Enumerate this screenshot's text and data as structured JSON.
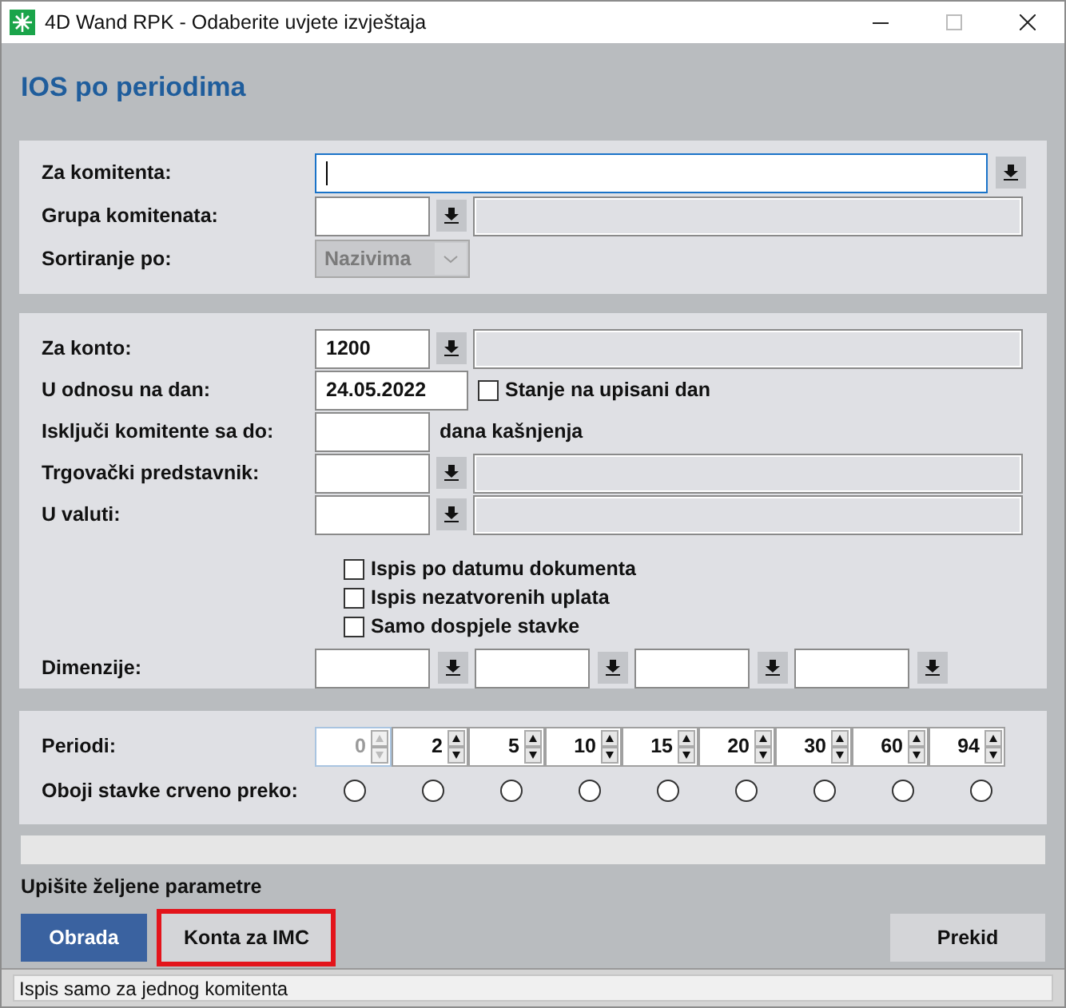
{
  "window": {
    "title": "4D Wand RPK - Odaberite uvjete izvještaja"
  },
  "heading": "IOS po periodima",
  "panel_1": [
    {
      "kind": "wide_lookup",
      "label": "Za komitenta:",
      "focused": true
    },
    {
      "kind": "lookup",
      "label": "Grupa komitenata:"
    },
    {
      "kind": "select",
      "label": "Sortiranje po:",
      "value": "Nazivima",
      "disabled": true
    }
  ],
  "panel_2": [
    {
      "kind": "lookup",
      "label": "Za konto:",
      "value": "1200"
    },
    {
      "kind": "date",
      "label": "U odnosu na dan:",
      "value": "24.05.2022",
      "option": {
        "label": "Stanje na upisani dan",
        "checked": false
      }
    },
    {
      "kind": "days",
      "label": "Isključi komitente sa do:",
      "suffix": "dana kašnjenja"
    },
    {
      "kind": "lookup",
      "label": "Trgovački predstavnik:"
    },
    {
      "kind": "lookup",
      "label": "U valuti:"
    },
    {
      "kind": "checkbox",
      "label": "Ispis po datumu dokumenta",
      "checked": false
    },
    {
      "kind": "checkbox",
      "label": "Ispis nezatvorenih uplata",
      "checked": false
    },
    {
      "kind": "checkbox",
      "label": "Samo dospjele stavke",
      "checked": false
    },
    {
      "kind": "dimensions",
      "label": "Dimenzije:"
    }
  ],
  "periods": {
    "label": "Periodi:",
    "values": [
      {
        "value": "0",
        "disabled": true
      },
      {
        "value": "2",
        "disabled": false
      },
      {
        "value": "5",
        "disabled": false
      },
      {
        "value": "10",
        "disabled": false
      },
      {
        "value": "15",
        "disabled": false
      },
      {
        "value": "20",
        "disabled": false
      },
      {
        "value": "30",
        "disabled": false
      },
      {
        "value": "60",
        "disabled": false
      },
      {
        "value": "94",
        "disabled": false
      }
    ]
  },
  "color_over": {
    "label": "Oboji stavke crveno preko:",
    "options": [
      {
        "selected": false
      },
      {
        "selected": false
      },
      {
        "selected": false
      },
      {
        "selected": false
      },
      {
        "selected": false
      },
      {
        "selected": false
      },
      {
        "selected": false
      },
      {
        "selected": false
      },
      {
        "selected": false
      }
    ]
  },
  "hint": "Upišite željene parametre",
  "buttons": [
    {
      "kind": "primary",
      "label": "Obrada",
      "highlighted": false
    },
    {
      "kind": "normal",
      "label": "Konta za IMC",
      "highlighted": true
    },
    {
      "kind": "spacer"
    },
    {
      "kind": "normal",
      "label": "Prekid",
      "highlighted": false
    }
  ],
  "status_bar": "Ispis samo za jednog komitenta"
}
